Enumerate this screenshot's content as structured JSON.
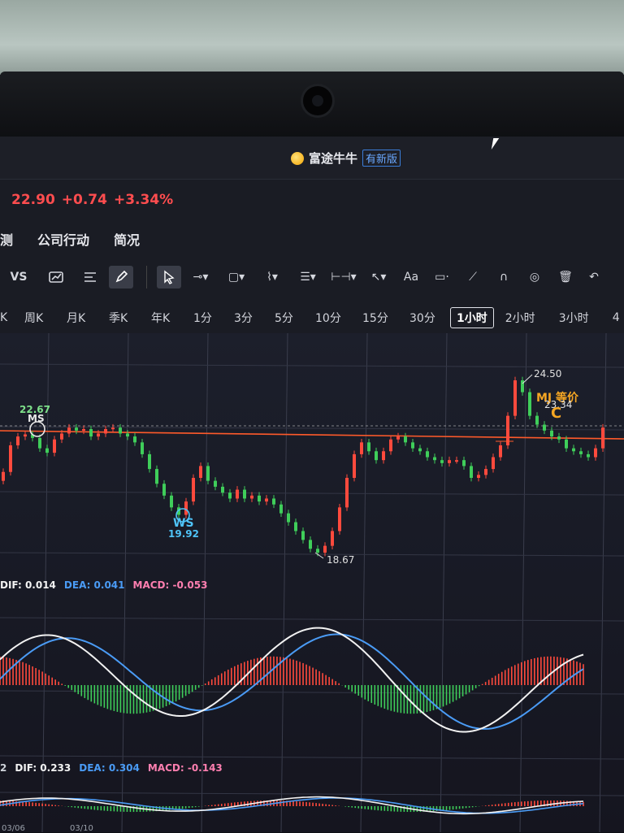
{
  "app": {
    "title": "富途牛牛",
    "badge": "有新版"
  },
  "quote": {
    "price": "22.90",
    "change": "+0.74",
    "change_pct": "+3.34%"
  },
  "nav_tabs": [
    "测",
    "公司行动",
    "简况"
  ],
  "toolbar": {
    "vs_label": "VS",
    "text_tool_label": "Aa",
    "icons": [
      "trend-chart-icon",
      "list-lines-icon",
      "pencil-draw-icon",
      "cursor-arrow-icon",
      "line-tool-icon",
      "rectangle-tool-icon",
      "wave-tool-icon",
      "fib-tool-icon",
      "measure-tool-icon",
      "arrow-tool-icon",
      "text-tool-icon",
      "comment-tool-icon",
      "brush-tool-icon",
      "magnet-icon",
      "eye-icon",
      "trash-icon",
      "undo-icon"
    ]
  },
  "periods": [
    "K",
    "周K",
    "月K",
    "季K",
    "年K",
    "1分",
    "3分",
    "5分",
    "10分",
    "15分",
    "30分",
    "1小时",
    "2小时",
    "3小时",
    "4"
  ],
  "selected_period": "1小时",
  "annotations": {
    "high_left": "22.67",
    "ms": "MS",
    "ws": "WS",
    "ws_price": "19.92",
    "low": "18.67",
    "high": "24.50",
    "mj": "MJ 等价",
    "mj_price": "23.34",
    "c": "C"
  },
  "macd1": {
    "dif": "DIF: 0.014",
    "dea": "DEA: 0.041",
    "macd": "MACD: -0.053"
  },
  "macd2": {
    "prefix": "2",
    "dif": "DIF: 0.233",
    "dea": "DEA: 0.304",
    "macd": "MACD: -0.143"
  },
  "dates": [
    "03/06",
    "03/10"
  ],
  "colors": {
    "up": "#ff4a3d",
    "down": "#3fce5a",
    "dif": "#f2f2f2",
    "dea": "#4a9bf5",
    "macd_label": "#ff7fb0",
    "accent": "#f5a623",
    "ref_line": "#ff5a2a"
  },
  "chart_data": {
    "type": "candlestick",
    "price_markers": {
      "high": 24.5,
      "low": 18.67,
      "ws": 19.92,
      "ms": 22.67,
      "mj": 23.34,
      "current": 22.9
    },
    "close_path": [
      21.4,
      22.3,
      22.6,
      22.67,
      22.55,
      22.2,
      22.05,
      22.5,
      22.7,
      22.9,
      22.8,
      22.85,
      22.6,
      22.7,
      22.85,
      22.9,
      22.7,
      22.6,
      22.4,
      22.0,
      21.5,
      21.0,
      20.6,
      20.2,
      19.95,
      20.4,
      21.2,
      21.6,
      21.1,
      20.9,
      20.7,
      20.5,
      20.8,
      20.5,
      20.6,
      20.4,
      20.5,
      20.3,
      20.0,
      19.7,
      19.4,
      19.1,
      18.8,
      18.67,
      18.9,
      19.4,
      20.2,
      21.2,
      22.0,
      22.4,
      22.1,
      21.8,
      22.1,
      22.5,
      22.6,
      22.4,
      22.2,
      22.1,
      21.9,
      21.8,
      21.7,
      21.8,
      21.8,
      21.6,
      21.2,
      21.3,
      21.5,
      21.9,
      22.3,
      23.3,
      24.5,
      24.1,
      23.3,
      23.0,
      22.8,
      22.6,
      22.5,
      22.2,
      22.1,
      22.0,
      21.9,
      22.2,
      22.9
    ]
  }
}
